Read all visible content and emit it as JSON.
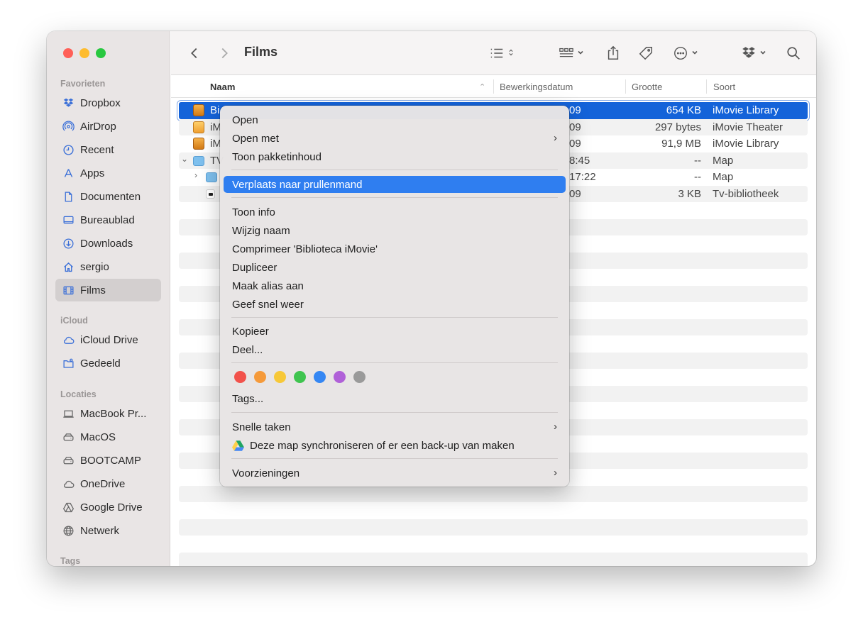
{
  "window": {
    "title": "Films"
  },
  "sidebar": {
    "sections": [
      {
        "label": "Favorieten"
      },
      {
        "label": "iCloud"
      },
      {
        "label": "Locaties"
      },
      {
        "label": "Tags"
      }
    ],
    "favorites": [
      {
        "label": "Dropbox",
        "icon": "dropbox-icon"
      },
      {
        "label": "AirDrop",
        "icon": "airdrop-icon"
      },
      {
        "label": "Recent",
        "icon": "clock-icon"
      },
      {
        "label": "Apps",
        "icon": "apps-icon"
      },
      {
        "label": "Documenten",
        "icon": "document-icon"
      },
      {
        "label": "Bureaublad",
        "icon": "desktop-icon"
      },
      {
        "label": "Downloads",
        "icon": "download-icon"
      },
      {
        "label": "sergio",
        "icon": "home-icon"
      },
      {
        "label": "Films",
        "icon": "film-icon",
        "selected": true
      }
    ],
    "icloud": [
      {
        "label": "iCloud Drive",
        "icon": "cloud-icon"
      },
      {
        "label": "Gedeeld",
        "icon": "shared-folder-icon"
      }
    ],
    "locations": [
      {
        "label": "MacBook Pr...",
        "icon": "laptop-icon"
      },
      {
        "label": "MacOS",
        "icon": "drive-icon"
      },
      {
        "label": "BOOTCAMP",
        "icon": "drive-icon"
      },
      {
        "label": "OneDrive",
        "icon": "cloud-icon"
      },
      {
        "label": "Google Drive",
        "icon": "google-drive-icon"
      },
      {
        "label": "Netwerk",
        "icon": "globe-icon"
      }
    ]
  },
  "columns": {
    "name": "Naam",
    "date": "Bewerkingsdatum",
    "size": "Grootte",
    "kind": "Soort"
  },
  "rows": [
    {
      "name": "Bi",
      "date": "09",
      "size": "654 KB",
      "kind": "iMovie Library",
      "icon": "imovie-library-icon",
      "selected": true
    },
    {
      "name": "iM",
      "date": "09",
      "size": "297 bytes",
      "kind": "iMovie Theater",
      "icon": "imovie-theater-icon"
    },
    {
      "name": "iM",
      "date": "09",
      "size": "91,9 MB",
      "kind": "iMovie Library",
      "icon": "imovie-library-icon"
    },
    {
      "name": "TV",
      "date": "8:45",
      "size": "--",
      "kind": "Map",
      "icon": "folder-icon",
      "disclosure": "open"
    },
    {
      "name": "",
      "date": "17:22",
      "size": "--",
      "kind": "Map",
      "icon": "folder-icon",
      "disclosure": "closed"
    },
    {
      "name": "",
      "date": "09",
      "size": "3 KB",
      "kind": "Tv-bibliotheek",
      "icon": "tv-library-icon"
    }
  ],
  "context_menu": {
    "open": "Open",
    "open_with": "Open met",
    "show_package": "Toon pakketinhoud",
    "move_to_trash": "Verplaats naar prullenmand",
    "get_info": "Toon info",
    "rename": "Wijzig naam",
    "compress": "Comprimeer 'Biblioteca iMovie'",
    "duplicate": "Dupliceer",
    "make_alias": "Maak alias aan",
    "quick_look": "Geef snel weer",
    "copy": "Kopieer",
    "share": "Deel...",
    "tag_colors": [
      "#f2524b",
      "#f59a3a",
      "#f7c838",
      "#3fc44f",
      "#3587f3",
      "#b061d8",
      "#9a9a9a"
    ],
    "tags": "Tags...",
    "quick_actions": "Snelle taken",
    "gdrive_sync": "Deze map synchroniseren of er een back-up van maken",
    "services": "Voorzieningen"
  }
}
